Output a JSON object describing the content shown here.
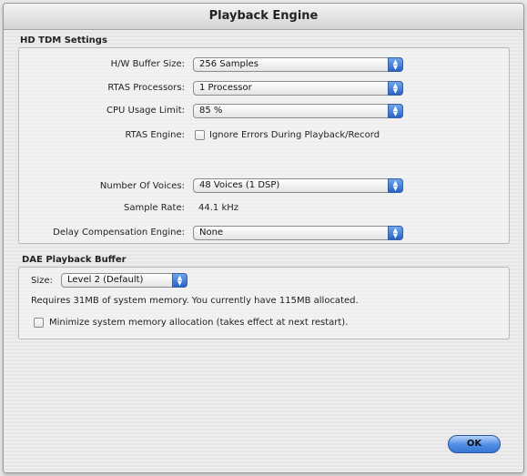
{
  "window": {
    "title": "Playback Engine"
  },
  "hd_tdm": {
    "section_title": "HD TDM Settings",
    "hw_buffer": {
      "label": "H/W Buffer Size:",
      "value": "256 Samples"
    },
    "rtas_processors": {
      "label": "RTAS Processors:",
      "value": "1 Processor"
    },
    "cpu_usage": {
      "label": "CPU Usage Limit:",
      "value": "85 %"
    },
    "rtas_engine": {
      "label": "RTAS Engine:",
      "checkbox_label": "Ignore Errors During Playback/Record",
      "checked": false
    },
    "voices": {
      "label": "Number Of Voices:",
      "value": "48 Voices (1 DSP)"
    },
    "sample_rate": {
      "label": "Sample Rate:",
      "value": "44.1 kHz"
    },
    "delay_comp": {
      "label": "Delay Compensation Engine:",
      "value": "None"
    }
  },
  "dae": {
    "section_title": "DAE Playback Buffer",
    "size": {
      "label": "Size:",
      "value": "Level 2 (Default)"
    },
    "memory_text": "Requires 31MB of system memory. You currently have 115MB allocated.",
    "minimize": {
      "checkbox_label": "Minimize system memory allocation (takes effect at next restart).",
      "checked": false
    }
  },
  "buttons": {
    "ok_label": "OK"
  },
  "colors": {
    "accent": "#2763c8",
    "window_bg": "#ececec"
  },
  "icons": {
    "popup_arrows": "up-down-arrows-icon"
  }
}
